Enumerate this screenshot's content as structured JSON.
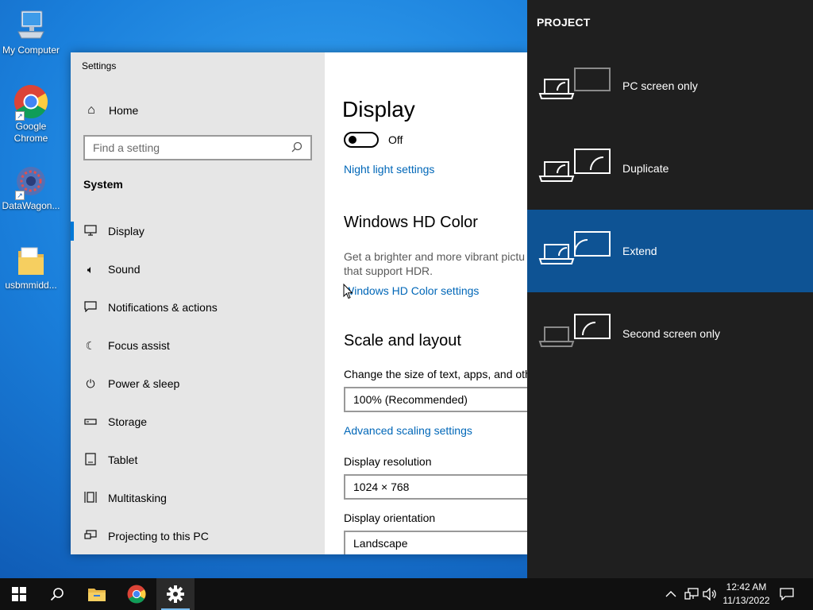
{
  "desktop": {
    "icons": [
      {
        "label": "My Computer"
      },
      {
        "label": "Google Chrome"
      },
      {
        "label": "DataWagon..."
      },
      {
        "label": "usbmmidd..."
      }
    ]
  },
  "settings": {
    "window_title": "Settings",
    "home_label": "Home",
    "search_placeholder": "Find a setting",
    "section_label": "System",
    "nav": [
      {
        "label": "Display",
        "icon": "monitor-icon"
      },
      {
        "label": "Sound",
        "icon": "speaker-icon"
      },
      {
        "label": "Notifications & actions",
        "icon": "notification-icon"
      },
      {
        "label": "Focus assist",
        "icon": "moon-icon"
      },
      {
        "label": "Power & sleep",
        "icon": "power-icon"
      },
      {
        "label": "Storage",
        "icon": "storage-icon"
      },
      {
        "label": "Tablet",
        "icon": "tablet-icon"
      },
      {
        "label": "Multitasking",
        "icon": "multitasking-icon"
      },
      {
        "label": "Projecting to this PC",
        "icon": "projecting-icon"
      }
    ],
    "content": {
      "title": "Display",
      "night_light_state": "Off",
      "night_light_link": "Night light settings",
      "hd_color_heading": "Windows HD Color",
      "hd_color_desc_line1": "Get a brighter and more vibrant pictu",
      "hd_color_desc_line2": "that support HDR.",
      "hd_color_link": "Windows HD Color settings",
      "scale_heading": "Scale and layout",
      "scale_label": "Change the size of text, apps, and oth",
      "scale_value": "100% (Recommended)",
      "advanced_scaling_link": "Advanced scaling settings",
      "resolution_label": "Display resolution",
      "resolution_value": "1024 × 768",
      "orientation_label": "Display orientation",
      "orientation_value": "Landscape"
    }
  },
  "project": {
    "header": "PROJECT",
    "options": [
      {
        "label": "PC screen only",
        "selected": false
      },
      {
        "label": "Duplicate",
        "selected": false
      },
      {
        "label": "Extend",
        "selected": true
      },
      {
        "label": "Second screen only",
        "selected": false
      }
    ]
  },
  "taskbar": {
    "time": "12:42 AM",
    "date": "11/13/2022"
  },
  "colors": {
    "accent": "#0078d7",
    "link": "#0067b8",
    "project_bg": "#1f1f1f",
    "project_selected": "#0e5394",
    "taskbar": "#101010"
  }
}
